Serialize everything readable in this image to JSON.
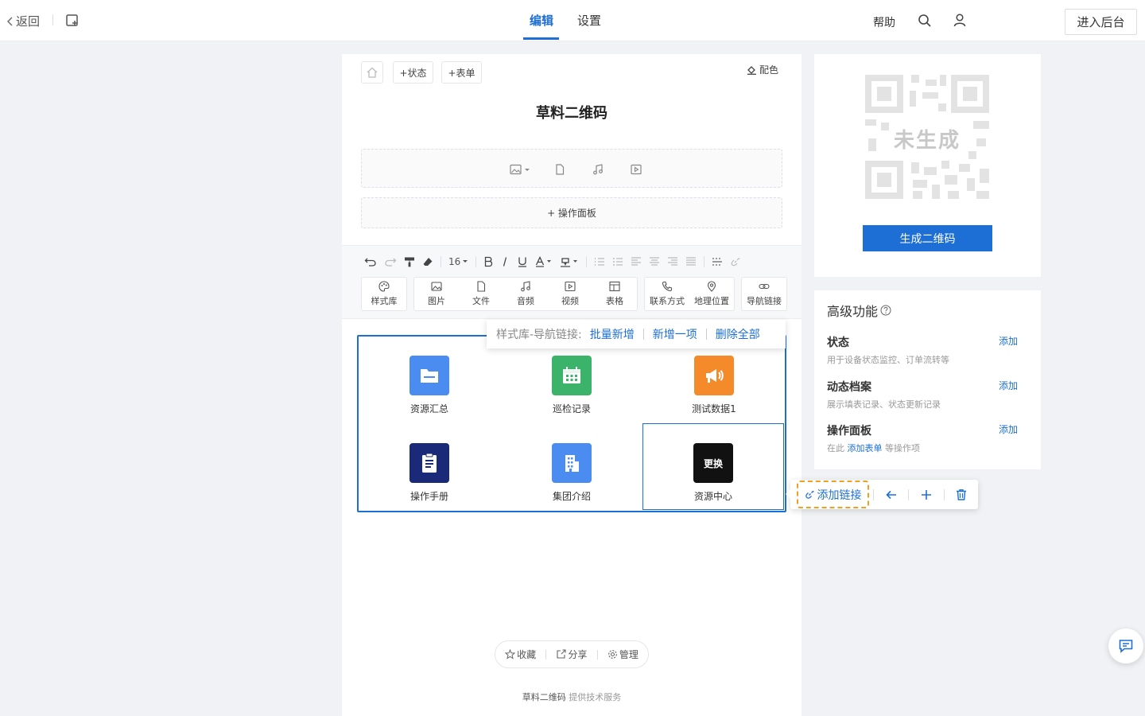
{
  "topbar": {
    "back_label": "返回",
    "tabs": [
      {
        "label": "编辑",
        "active": true
      },
      {
        "label": "设置",
        "active": false
      }
    ],
    "help_label": "帮助",
    "admin_label": "进入后台"
  },
  "editor": {
    "add_state_label": "+状态",
    "add_form_label": "+表单",
    "color_label": "配色",
    "title": "草料二维码",
    "op_panel_label": "+ 操作面板",
    "font_size": "16",
    "insert_tools": [
      {
        "icon": "palette-icon",
        "label": "样式库"
      },
      {
        "icon": "image-icon",
        "label": "图片"
      },
      {
        "icon": "file-icon",
        "label": "文件"
      },
      {
        "icon": "music-icon",
        "label": "音频"
      },
      {
        "icon": "video-icon",
        "label": "视频"
      },
      {
        "icon": "table-icon",
        "label": "表格"
      },
      {
        "icon": "phone-icon",
        "label": "联系方式"
      },
      {
        "icon": "location-icon",
        "label": "地理位置"
      },
      {
        "icon": "link-icon",
        "label": "导航链接"
      }
    ],
    "nav_items": [
      {
        "label": "资源汇总",
        "icon": "folder-icon",
        "color": "#4a8cf0"
      },
      {
        "label": "巡检记录",
        "icon": "calendar-icon",
        "color": "#3bb36b"
      },
      {
        "label": "测试数据1",
        "icon": "megaphone-icon",
        "color": "#f58a2b"
      },
      {
        "label": "操作手册",
        "icon": "clipboard-icon",
        "color": "#1a2a78"
      },
      {
        "label": "集团介绍",
        "icon": "building-icon",
        "color": "#4a8cf0"
      },
      {
        "label": "资源中心",
        "icon": "swap-icon",
        "color": "#111111",
        "icon_text": "更换",
        "selected": true
      }
    ],
    "popover": {
      "label": "样式库-导航链接:",
      "batch_add": "批量新增",
      "add_one": "新增一项",
      "delete_all": "删除全部"
    },
    "floatbar": {
      "add_link": "添加链接"
    },
    "footer": {
      "collect": "收藏",
      "share": "分享",
      "manage": "管理",
      "brand": "草料二维码",
      "powered": "提供技术服务"
    }
  },
  "qr_card": {
    "placeholder_text": "未生成",
    "generate_label": "生成二维码"
  },
  "advanced": {
    "title": "高级功能",
    "items": [
      {
        "name": "状态",
        "desc": "用于设备状态监控、订单流转等",
        "action": "添加"
      },
      {
        "name": "动态档案",
        "desc": "展示填表记录、状态更新记录",
        "action": "添加"
      },
      {
        "name": "操作面板",
        "desc_pre": "在此",
        "desc_link": "添加表单",
        "desc_post": "等操作项",
        "action": "添加"
      }
    ]
  },
  "colors": {
    "accent": "#1d6fd6",
    "highlight": "#f0a020"
  }
}
